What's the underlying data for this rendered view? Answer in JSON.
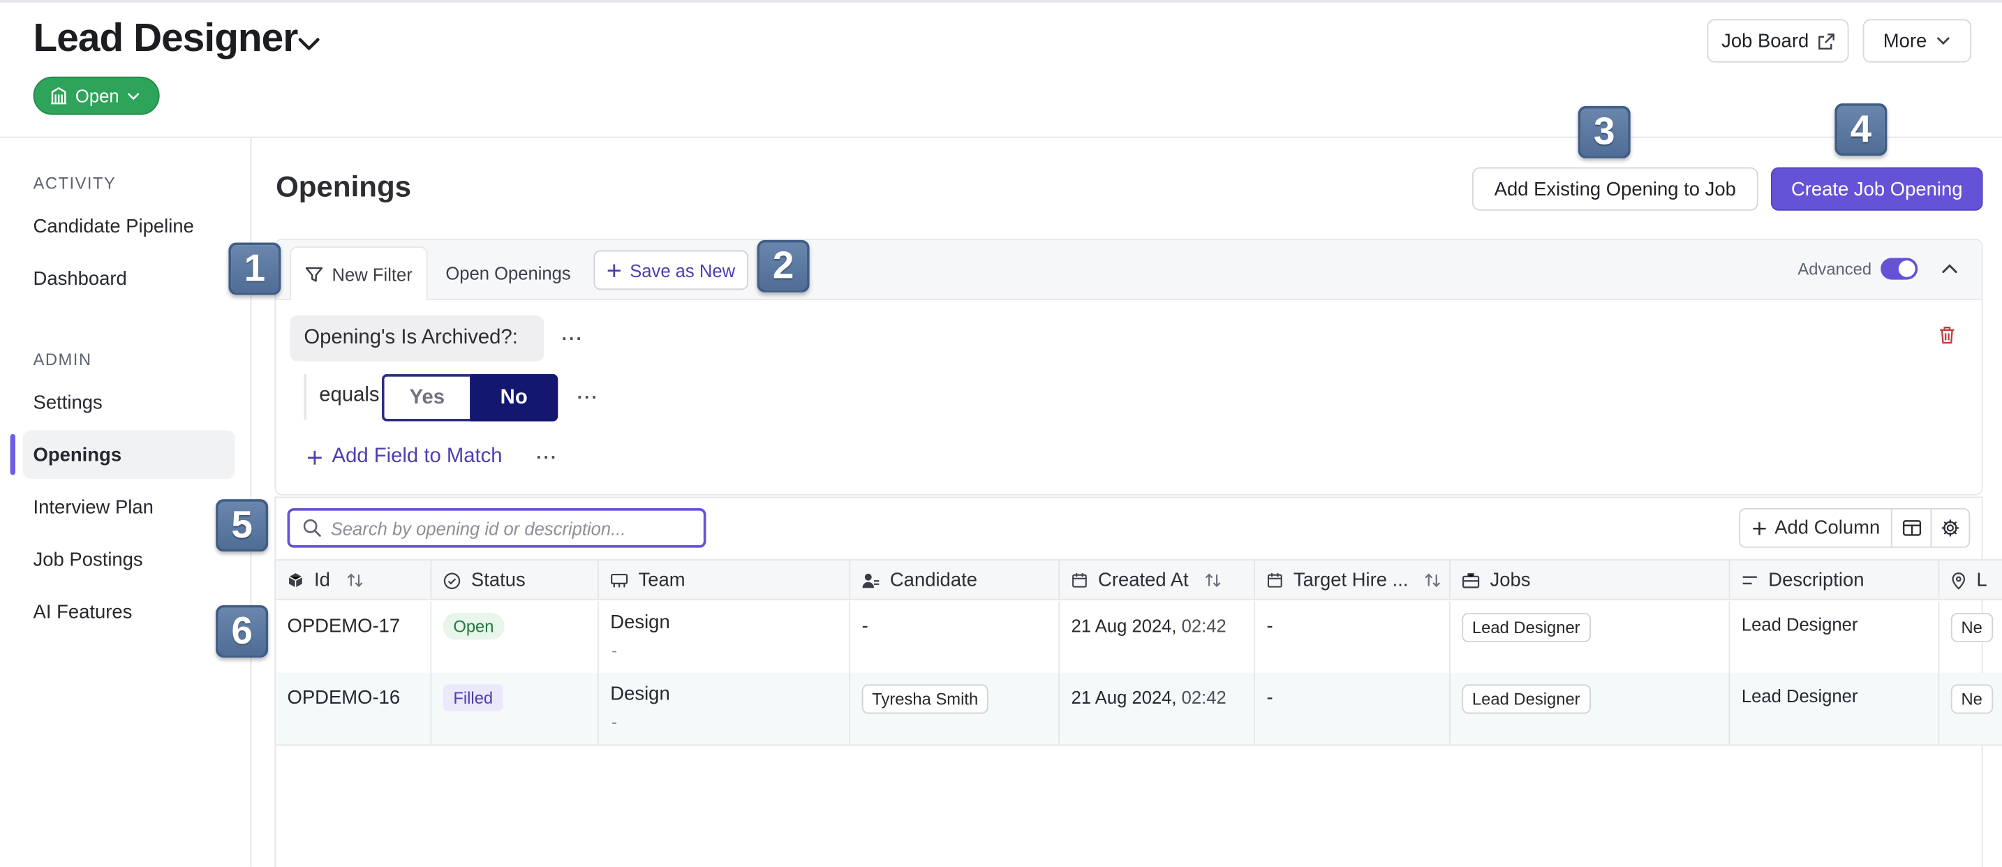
{
  "header": {
    "title": "Lead Designer",
    "status_label": "Open",
    "job_board_label": "Job Board",
    "more_label": "More"
  },
  "sidebar": {
    "activity_heading": "ACTIVITY",
    "activity_items": [
      {
        "label": "Candidate Pipeline"
      },
      {
        "label": "Dashboard"
      }
    ],
    "admin_heading": "ADMIN",
    "admin_items": [
      {
        "label": "Settings",
        "active": false
      },
      {
        "label": "Openings",
        "active": true
      },
      {
        "label": "Interview Plan",
        "active": false
      },
      {
        "label": "Job Postings",
        "active": false
      },
      {
        "label": "AI Features",
        "active": false
      }
    ]
  },
  "main": {
    "title": "Openings",
    "add_existing_label": "Add Existing Opening to Job",
    "create_label": "Create Job Opening"
  },
  "filters": {
    "tabs": [
      {
        "label": "New Filter",
        "active": true
      },
      {
        "label": "Open Openings",
        "active": false
      }
    ],
    "save_as_new_label": "Save as New",
    "advanced_label": "Advanced",
    "advanced_on": true,
    "condition": {
      "field": "Opening's Is Archived?:",
      "operator": "equals",
      "options": [
        {
          "label": "Yes",
          "selected": false
        },
        {
          "label": "No",
          "selected": true
        }
      ]
    },
    "add_field_label": "Add Field to Match",
    "more_glyph": "···"
  },
  "table": {
    "search_placeholder": "Search by opening id or description...",
    "add_column_label": "Add Column",
    "columns": [
      {
        "label": "Id",
        "icon": "cube-icon"
      },
      {
        "label": "Status",
        "icon": "check-circle-icon"
      },
      {
        "label": "Team",
        "icon": "team-icon"
      },
      {
        "label": "Candidate",
        "icon": "person-icon"
      },
      {
        "label": "Created At",
        "icon": "calendar-icon"
      },
      {
        "label": "Target Hire ...",
        "icon": "calendar-icon"
      },
      {
        "label": "Jobs",
        "icon": "briefcase-icon"
      },
      {
        "label": "Description",
        "icon": "lines-icon"
      },
      {
        "label": "L",
        "icon": "pin-icon"
      }
    ],
    "rows": [
      {
        "id": "OPDEMO-17",
        "status": "Open",
        "team": "Design",
        "team_sub": "-",
        "candidate": "-",
        "created_date": "21 Aug 2024,",
        "created_time": "02:42",
        "target_hire": "-",
        "job": "Lead Designer",
        "description": "Lead Designer",
        "location": "Ne"
      },
      {
        "id": "OPDEMO-16",
        "status": "Filled",
        "team": "Design",
        "team_sub": "-",
        "candidate": "Tyresha Smith",
        "created_date": "21 Aug 2024,",
        "created_time": "02:42",
        "target_hire": "-",
        "job": "Lead Designer",
        "description": "Lead Designer",
        "location": "Ne"
      }
    ]
  },
  "markers": [
    "1",
    "2",
    "3",
    "4",
    "5",
    "6"
  ],
  "colors": {
    "accent": "#6453d6",
    "status_open": "#2ea35a",
    "selected_segment": "#131770",
    "marker": "#5a77a0"
  }
}
